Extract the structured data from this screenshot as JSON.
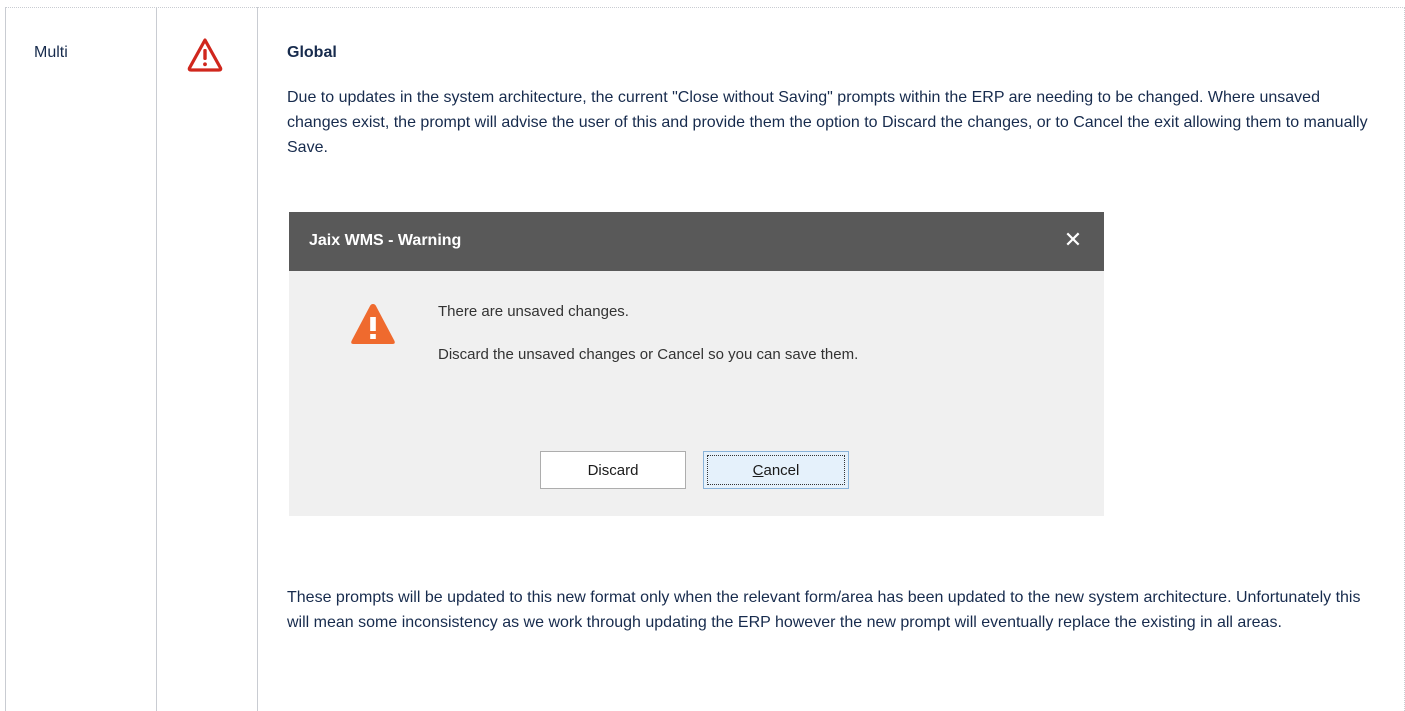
{
  "row": {
    "type_label": "Multi",
    "icon": "warning-triangle-outline-icon",
    "heading": "Global",
    "paragraph1": "Due to updates in the system architecture, the current \"Close without Saving\" prompts within the ERP are needing to be changed.  Where unsaved changes exist, the prompt will advise the user of this and provide them the option to Discard the changes, or to Cancel the exit allowing them to manually Save.",
    "paragraph2": "These prompts will be updated to this new format only when the relevant form/area has been updated to the new system architecture.   Unfortunately this will mean some inconsistency as we work through updating the ERP however the new prompt will eventually replace the existing in all areas."
  },
  "dialog": {
    "title": "Jaix WMS - Warning",
    "close_glyph": "✕",
    "icon": "warning-triangle-filled-icon",
    "message_line1": "There are unsaved changes.",
    "message_line2": "Discard the unsaved changes or Cancel so you can save them.",
    "discard_label": "Discard",
    "cancel_accel": "C",
    "cancel_rest": "ancel"
  },
  "colors": {
    "alert_red": "#d0271d",
    "dialog_titlebar": "#595959",
    "warning_orange": "#ef6a2e"
  }
}
